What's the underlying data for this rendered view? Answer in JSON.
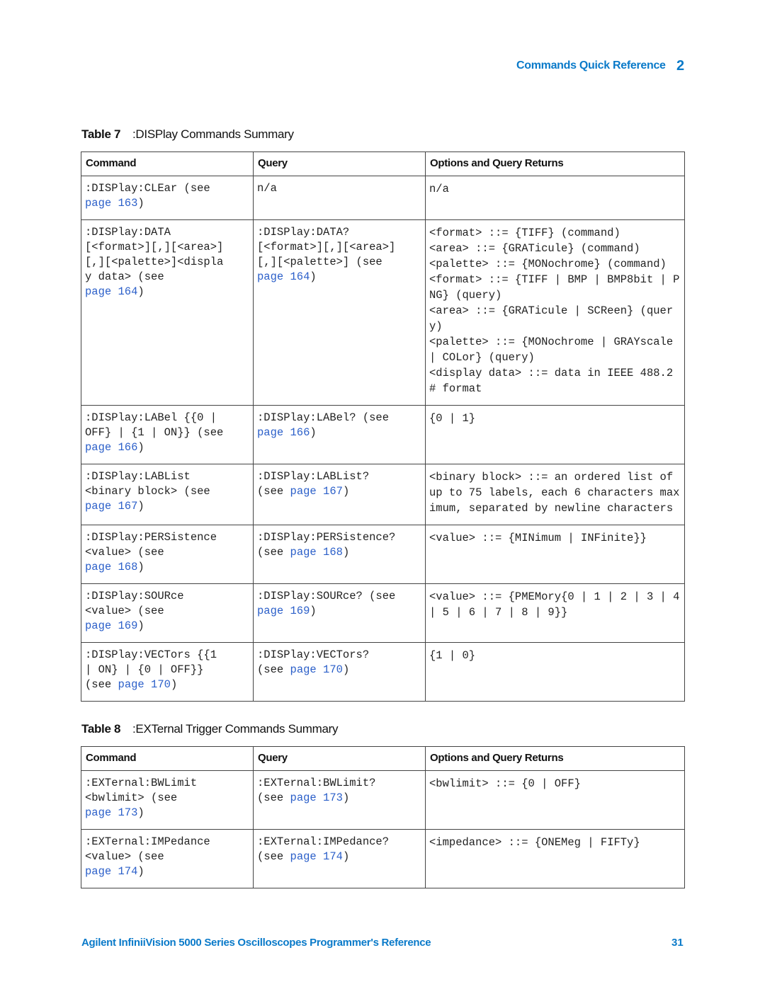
{
  "header": {
    "section_title": "Commands Quick Reference",
    "chapter_number": "2"
  },
  "colors": {
    "accent_blue": "#0a7ac9",
    "link_blue": "#2b5fc9"
  },
  "table7": {
    "label": "Table 7",
    "title": ":DISPlay Commands Summary",
    "columns": [
      "Command",
      "Query",
      "Options and Query Returns"
    ],
    "rows": [
      {
        "command": [
          ":DISPlay:CLEar (see "
        ],
        "command_link": "page 163",
        "command_suffix": ")",
        "query": [
          "n/a"
        ],
        "options": [
          "n/a"
        ]
      },
      {
        "command": [
          ":DISPlay:DATA",
          "[<format>][,][<area>]",
          "[,][<palette>]<displa",
          "y data> (see"
        ],
        "command_link": "page 164",
        "command_suffix": ")",
        "query": [
          ":DISPlay:DATA?",
          "[<format>][,][<area>]",
          "[,][<palette>] (see"
        ],
        "query_link": "page 164",
        "query_suffix": ")",
        "options": [
          "<format> ::= {TIFF} (command)",
          "<area> ::= {GRATicule} (command)",
          "<palette> ::= {MONochrome} (command)",
          "<format> ::= {TIFF | BMP | BMP8bit | PNG} (query)",
          "<area> ::= {GRATicule | SCReen} (query)",
          "<palette> ::= {MONochrome | GRAYscale | COLor} (query)",
          "<display data> ::= data in IEEE 488.2 # format"
        ]
      },
      {
        "command": [
          ":DISPlay:LABel {{0 |",
          "OFF} | {1 | ON}} (see"
        ],
        "command_link": "page 166",
        "command_suffix": ")",
        "query": [
          ":DISPlay:LABel? (see"
        ],
        "query_link": "page 166",
        "query_suffix": ")",
        "options": [
          "{0 | 1}"
        ]
      },
      {
        "command": [
          ":DISPlay:LABList",
          "<binary block> (see"
        ],
        "command_link": "page 167",
        "command_suffix": ")",
        "query": [
          ":DISPlay:LABList?"
        ],
        "query_prefix": "(see ",
        "query_link": "page 167",
        "query_suffix": ")",
        "options": [
          "<binary block> ::= an ordered list of up to 75 labels, each 6 characters maximum, separated by newline characters"
        ]
      },
      {
        "command": [
          ":DISPlay:PERSistence",
          "<value> (see"
        ],
        "command_link": "page 168",
        "command_suffix": ")",
        "query": [
          ":DISPlay:PERSistence?"
        ],
        "query_prefix": "(see ",
        "query_link": "page 168",
        "query_suffix": ")",
        "options": [
          "<value> ::= {MINimum | INFinite}}"
        ]
      },
      {
        "command": [
          ":DISPlay:SOURce",
          "<value> (see"
        ],
        "command_link": "page 169",
        "command_suffix": ")",
        "query": [
          ":DISPlay:SOURce? (see"
        ],
        "query_link": "page 169",
        "query_suffix": ")",
        "options": [
          "<value> ::= {PMEMory{0 | 1 | 2 | 3 | 4 | 5 | 6 | 7 | 8 | 9}}"
        ]
      },
      {
        "command": [
          ":DISPlay:VECTors {{1",
          "| ON} | {0 | OFF}}"
        ],
        "command_prefix": "(see ",
        "command_link": "page 170",
        "command_suffix": ")",
        "query": [
          ":DISPlay:VECTors?"
        ],
        "query_prefix": "(see ",
        "query_link": "page 170",
        "query_suffix": ")",
        "options": [
          "{1 | 0}"
        ]
      }
    ]
  },
  "table8": {
    "label": "Table 8",
    "title": ":EXTernal Trigger Commands Summary",
    "columns": [
      "Command",
      "Query",
      "Options and Query Returns"
    ],
    "rows": [
      {
        "command": [
          ":EXTernal:BWLimit",
          "<bwlimit> (see"
        ],
        "command_link": "page 173",
        "command_suffix": ")",
        "query": [
          ":EXTernal:BWLimit?"
        ],
        "query_prefix": "(see ",
        "query_link": "page 173",
        "query_suffix": ")",
        "options": [
          "<bwlimit> ::= {0 | OFF}"
        ]
      },
      {
        "command": [
          ":EXTernal:IMPedance",
          "<value> (see"
        ],
        "command_link": "page 174",
        "command_suffix": ")",
        "query": [
          ":EXTernal:IMPedance?"
        ],
        "query_prefix": "(see ",
        "query_link": "page 174",
        "query_suffix": ")",
        "options": [
          "<impedance> ::= {ONEMeg | FIFTy}"
        ]
      }
    ]
  },
  "footer": {
    "document_title": "Agilent InfiniiVision 5000 Series Oscilloscopes Programmer's Reference",
    "page_number": "31"
  }
}
